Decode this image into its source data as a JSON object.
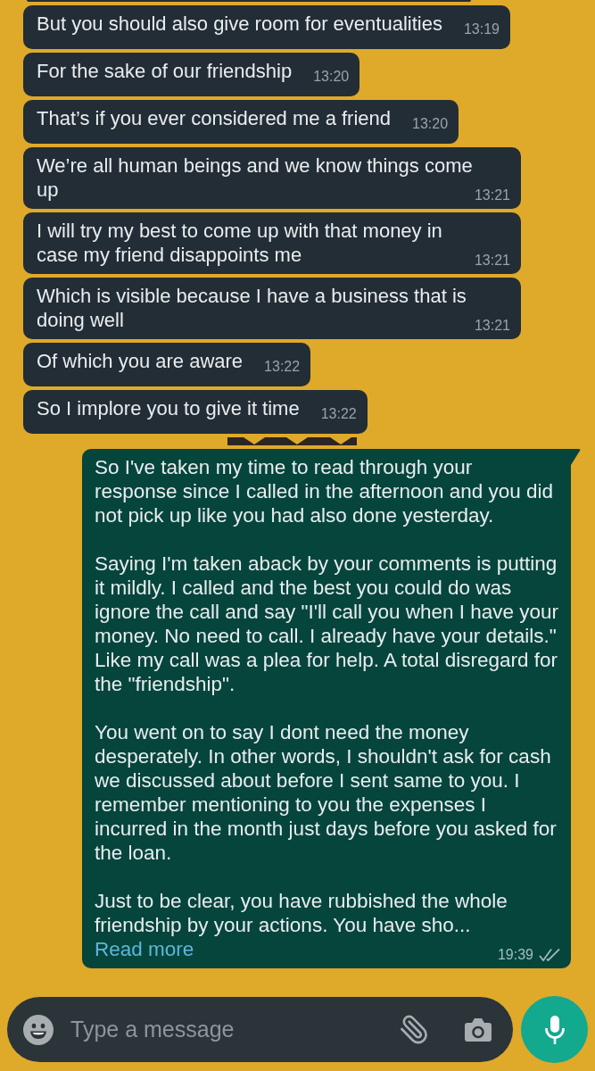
{
  "messages": [
    {
      "kind": "incoming",
      "text": "But you should also give room for eventualities",
      "time": "13:19"
    },
    {
      "kind": "incoming",
      "text": "For the sake of our friendship",
      "time": "13:20"
    },
    {
      "kind": "incoming",
      "text": "That’s if you ever considered me a friend",
      "time": "13:20"
    },
    {
      "kind": "incoming",
      "text": "We’re all human beings and we know things come up",
      "time": "13:21"
    },
    {
      "kind": "incoming",
      "text": "I will try my best to come up with that money in case my friend disappoints me",
      "time": "13:21"
    },
    {
      "kind": "incoming",
      "text": "Which is visible because I have a business that is doing well",
      "time": "13:21"
    },
    {
      "kind": "incoming",
      "text": "Of which you are aware",
      "time": "13:22"
    },
    {
      "kind": "incoming",
      "text": "So I implore you to give it time",
      "time": "13:22"
    },
    {
      "kind": "outgoing",
      "paragraphs": [
        "So I've taken my time to read through your response since I called in the afternoon and you did not pick up like you had also done yesterday.",
        "Saying I'm taken aback by your comments is putting it mildly. I called and the best you could do was ignore the call and say \"I'll call you when I have your money. No need to call. I already have your details.\" Like my call was a plea for help. A total disregard for the \"friendship\".",
        "You went on to say I dont need the money desperately. In other words, I shouldn't ask for cash we discussed about before I sent same to you. I remember mentioning to you the expenses I incurred in the month just days before you asked for the loan.",
        "Just to be clear, you have rubbished the whole friendship by your actions. You have sho..."
      ],
      "read_more": "Read more",
      "time": "19:39",
      "delivered": true,
      "read": false
    }
  ],
  "composer": {
    "placeholder": "Type a message"
  }
}
